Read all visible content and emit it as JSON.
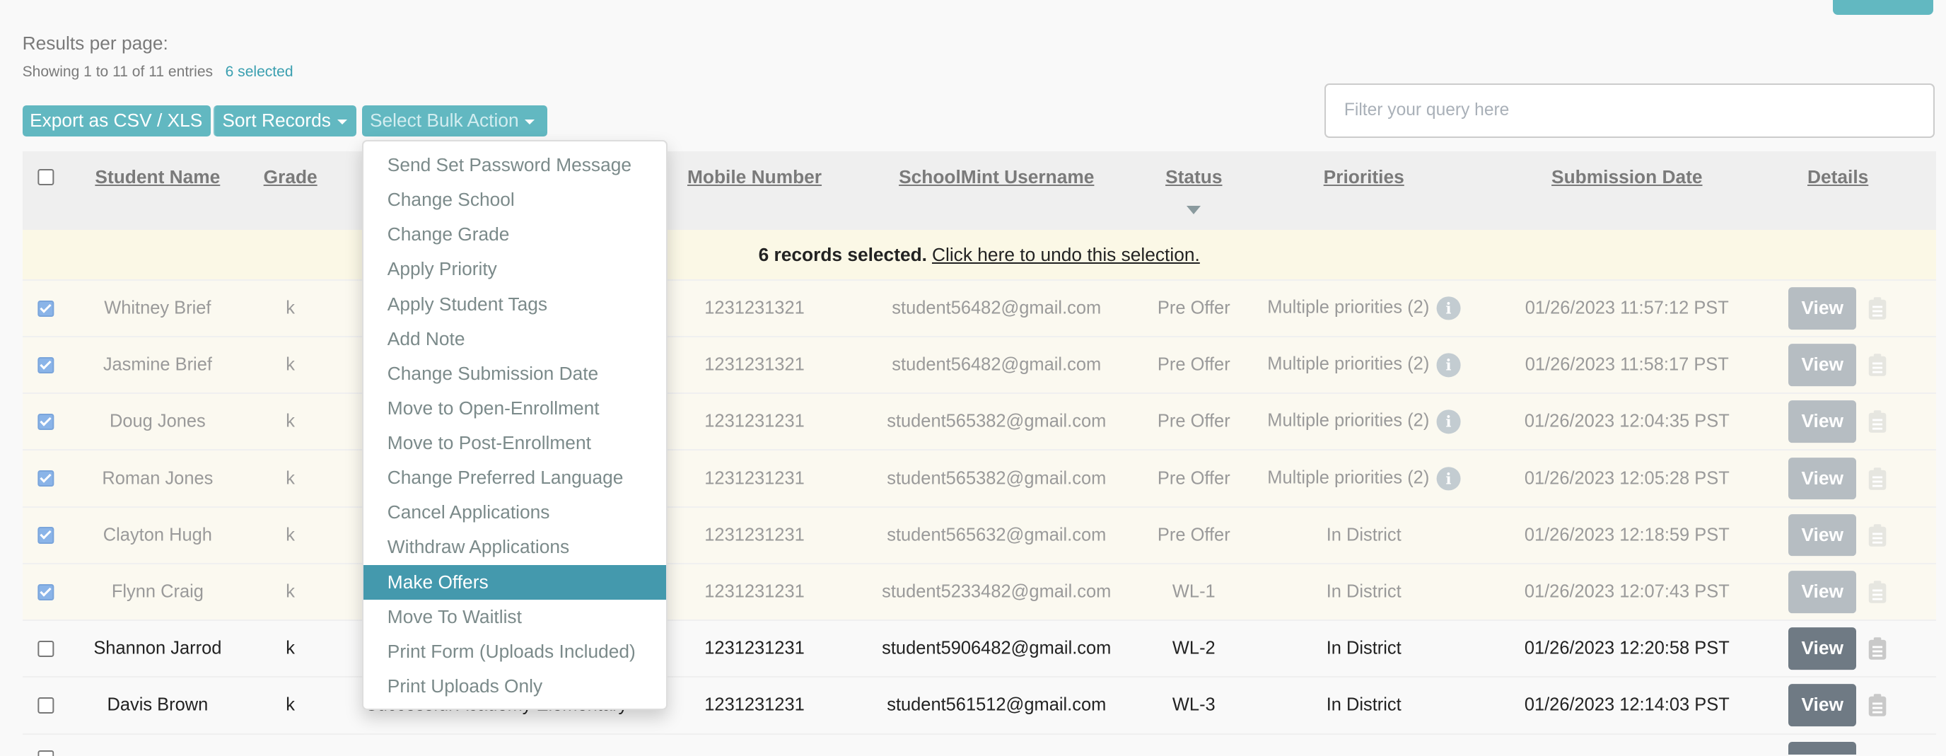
{
  "header": {
    "results_per_page_label": "Results per page:",
    "showing_text": "Showing 1 to 11 of 11 entries",
    "selected_text": "6 selected"
  },
  "toolbar": {
    "export_label": "Export as CSV / XLS",
    "sort_label": "Sort Records",
    "bulk_label": "Select Bulk Action"
  },
  "filter": {
    "placeholder": "Filter your query here",
    "value": ""
  },
  "colors": {
    "accent": "#62b8c1",
    "menu_highlight": "#4499ad",
    "selected_row": "#fbf9f0",
    "banner": "#fbf8e6"
  },
  "table": {
    "columns": [
      "Student Name",
      "Grade",
      "Mobile Number",
      "SchoolMint Username",
      "Status",
      "Priorities",
      "Submission Date",
      "Details"
    ],
    "sorted_column": "Status",
    "banner_bold": "6 records selected.",
    "banner_link": "Click here to undo this selection.",
    "view_label": "View",
    "rows": [
      {
        "checked": true,
        "name": "Whitney Brief",
        "grade": "k",
        "school": "",
        "mobile": "1231231321",
        "username": "student56482@gmail.com",
        "status": "Pre Offer",
        "priorities": "Multiple priorities (2)",
        "priority_info": true,
        "date": "01/26/2023 11:57:12 PST"
      },
      {
        "checked": true,
        "name": "Jasmine Brief",
        "grade": "k",
        "school": "",
        "mobile": "1231231321",
        "username": "student56482@gmail.com",
        "status": "Pre Offer",
        "priorities": "Multiple priorities (2)",
        "priority_info": true,
        "date": "01/26/2023 11:58:17 PST"
      },
      {
        "checked": true,
        "name": "Doug Jones",
        "grade": "k",
        "school": "",
        "mobile": "1231231231",
        "username": "student565382@gmail.com",
        "status": "Pre Offer",
        "priorities": "Multiple priorities (2)",
        "priority_info": true,
        "date": "01/26/2023 12:04:35 PST"
      },
      {
        "checked": true,
        "name": "Roman Jones",
        "grade": "k",
        "school": "",
        "mobile": "1231231231",
        "username": "student565382@gmail.com",
        "status": "Pre Offer",
        "priorities": "Multiple priorities (2)",
        "priority_info": true,
        "date": "01/26/2023 12:05:28 PST"
      },
      {
        "checked": true,
        "name": "Clayton Hugh",
        "grade": "k",
        "school": "",
        "mobile": "1231231231",
        "username": "student565632@gmail.com",
        "status": "Pre Offer",
        "priorities": "In District",
        "priority_info": false,
        "date": "01/26/2023 12:18:59 PST"
      },
      {
        "checked": true,
        "name": "Flynn Craig",
        "grade": "k",
        "school": "",
        "mobile": "1231231231",
        "username": "student5233482@gmail.com",
        "status": "WL-1",
        "priorities": "In District",
        "priority_info": false,
        "date": "01/26/2023 12:07:43 PST"
      },
      {
        "checked": false,
        "name": "Shannon Jarrod",
        "grade": "k",
        "school": "",
        "mobile": "1231231231",
        "username": "student5906482@gmail.com",
        "status": "WL-2",
        "priorities": "In District",
        "priority_info": false,
        "date": "01/26/2023 12:20:58 PST"
      },
      {
        "checked": false,
        "name": "Davis Brown",
        "grade": "k",
        "school": "Successful Academy Elementary",
        "mobile": "1231231231",
        "username": "student561512@gmail.com",
        "status": "WL-3",
        "priorities": "In District",
        "priority_info": false,
        "date": "01/26/2023 12:14:03 PST"
      },
      {
        "checked": false,
        "name": "",
        "grade": "",
        "school": "",
        "mobile": "",
        "username": "",
        "status": "",
        "priorities": "",
        "priority_info": false,
        "date": ""
      }
    ]
  },
  "bulk_menu": {
    "highlighted": "Make Offers",
    "items": [
      "Send Set Password Message",
      "Change School",
      "Change Grade",
      "Apply Priority",
      "Apply Student Tags",
      "Add Note",
      "Change Submission Date",
      "Move to Open-Enrollment",
      "Move to Post-Enrollment",
      "Change Preferred Language",
      "Cancel Applications",
      "Withdraw Applications",
      "Make Offers",
      "Move To Waitlist",
      "Print Form (Uploads Included)",
      "Print Uploads Only"
    ]
  }
}
